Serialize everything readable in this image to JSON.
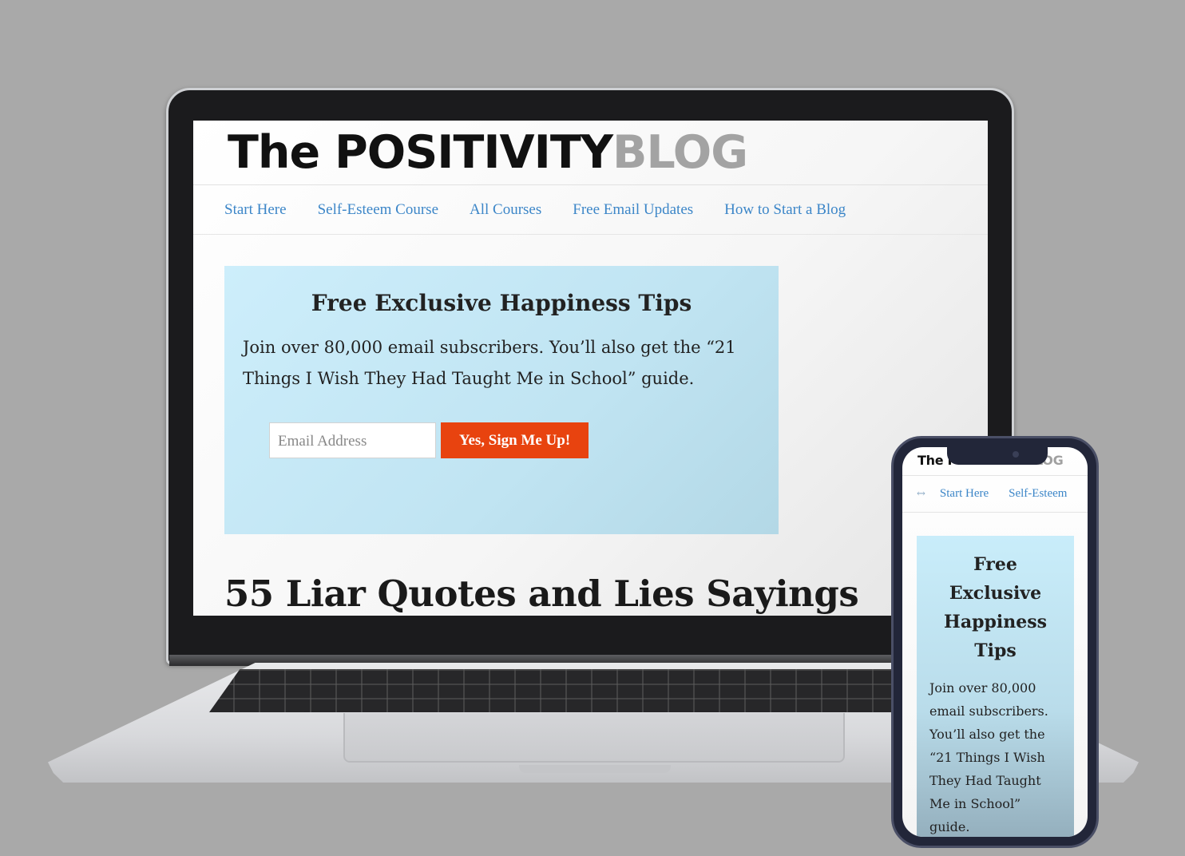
{
  "desktop": {
    "logo": {
      "part1": "The POSITIVITY",
      "part2": "BLOG"
    },
    "nav": [
      "Start Here",
      "Self-Esteem Course",
      "All Courses",
      "Free Email Updates",
      "How to Start a Blog"
    ],
    "optin": {
      "title": "Free Exclusive Happiness Tips",
      "body": "Join over 80,000 email subscribers. You’ll also get the “21 Things I Wish They Had Taught Me in School” guide.",
      "email_placeholder": "Email Address",
      "button_label": "Yes, Sign Me Up!"
    },
    "post_title": "55 Liar Quotes and Lies Sayings"
  },
  "mobile": {
    "logo": {
      "part1": "The POSITIVITY",
      "part2": "BLOG"
    },
    "scroll_arrow": "↔",
    "nav": [
      "Start Here",
      "Self-Esteem"
    ],
    "optin": {
      "title": "Free Exclusive Happiness Tips",
      "body": "Join over 80,000 email subscribers. You’ll also get the “21 Things I Wish They Had Taught Me in School” guide."
    }
  },
  "colors": {
    "link": "#3c86c8",
    "button": "#e8430f",
    "optin_bg": "#c8ebf8",
    "backdrop": "#a9a9a9"
  },
  "icons": [
    "scroll-arrow-icon"
  ]
}
